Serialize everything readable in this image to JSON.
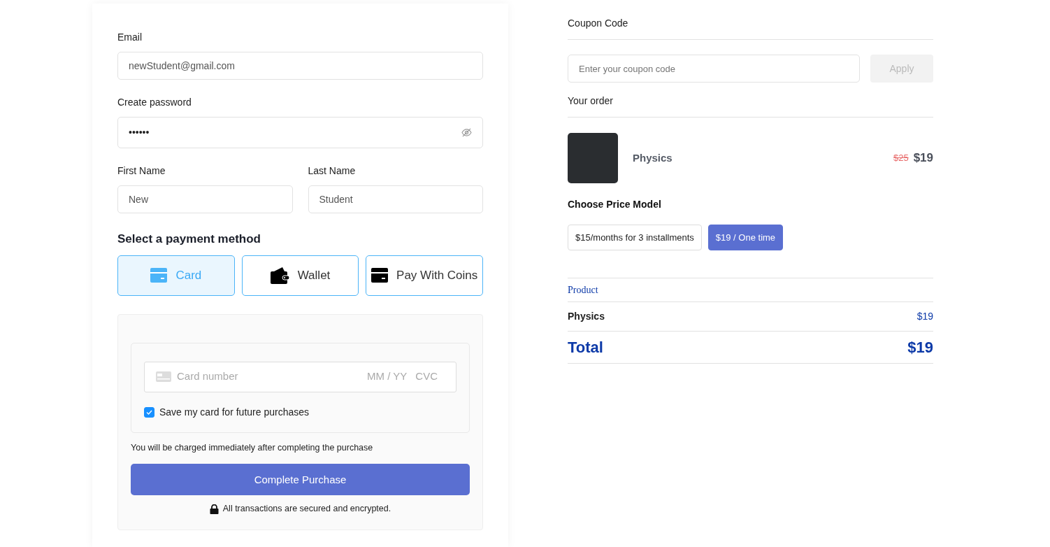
{
  "account": {
    "email": {
      "label": "Email",
      "value": "newStudent@gmail.com"
    },
    "password": {
      "label": "Create password",
      "value": "••••••"
    },
    "first_name": {
      "label": "First Name",
      "value": "New"
    },
    "last_name": {
      "label": "Last Name",
      "value": "Student"
    }
  },
  "payment": {
    "title": "Select a payment method",
    "methods": [
      {
        "label": "Card",
        "kind": "card",
        "selected": true
      },
      {
        "label": "Wallet",
        "kind": "wallet",
        "selected": false
      },
      {
        "label": "Pay With Coins",
        "kind": "coins",
        "selected": false
      }
    ],
    "card_field": {
      "number_placeholder": "Card number",
      "expiry_placeholder": "MM / YY",
      "cvc_placeholder": "CVC"
    },
    "save_card": {
      "label": "Save my card for future purchases",
      "checked": true
    },
    "note": "You will be charged immediately after completing the purchase",
    "submit": "Complete Purchase",
    "secure_note": "All transactions are secured and encrypted."
  },
  "coupon": {
    "title": "Coupon Code",
    "placeholder": "Enter your coupon code",
    "apply": "Apply",
    "apply_disabled": true
  },
  "order": {
    "title": "Your order",
    "item": {
      "name": "Physics",
      "old_price": "$25",
      "price": "$19"
    },
    "price_model_title": "Choose Price Model",
    "price_models": [
      {
        "label": "$15/months for 3 installments",
        "selected": false
      },
      {
        "label": "$19 / One time",
        "selected": true
      }
    ],
    "summary": {
      "header": "Product",
      "rows": [
        {
          "name": "Physics",
          "price": "$19"
        }
      ],
      "total_label": "Total",
      "total": "$19"
    }
  }
}
